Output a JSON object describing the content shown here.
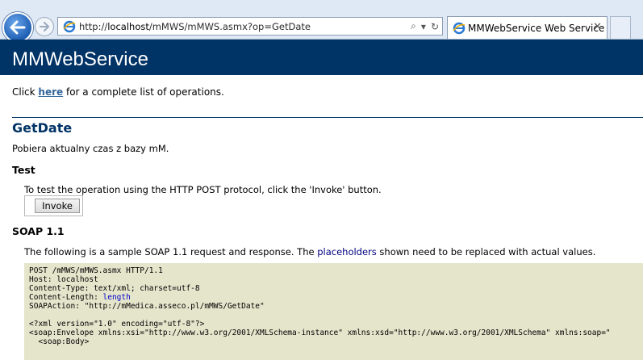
{
  "browser": {
    "address_url_prefix": "http://",
    "address_host": "localhost",
    "address_path": "/mMWS/mMWS.asmx?op=GetDate",
    "tab_title": "MMWebService Web Service",
    "tab_close": "✕",
    "search_glyph": "⌕",
    "dropdown_glyph": "▾",
    "refresh_glyph": "↻"
  },
  "page": {
    "service_name": "MMWebService",
    "intro_before": "Click ",
    "intro_link": "here",
    "intro_after": " for a complete list of operations.",
    "operation_name": "GetDate",
    "operation_description": "Pobiera aktualny czas z bazy mM.",
    "test_heading": "Test",
    "test_text": "To test the operation using the HTTP POST protocol, click the 'Invoke' button.",
    "invoke_label": "Invoke",
    "soap_heading": "SOAP 1.1",
    "soap_desc_before": "The following is a sample SOAP 1.1 request and response. The ",
    "soap_desc_link": "placeholders",
    "soap_desc_after": " shown need to be replaced with actual values."
  },
  "code": {
    "line1": "POST /mMWS/mMWS.asmx HTTP/1.1",
    "line2": "Host: localhost",
    "line3": "Content-Type: text/xml; charset=utf-8",
    "line4_key": "Content-Length: ",
    "line4_val": "length",
    "line5": "SOAPAction: \"http://mMedica.asseco.pl/mMWS/GetDate\"",
    "line6": "<?xml version=\"1.0\" encoding=\"utf-8\"?>",
    "line7": "<soap:Envelope xmlns:xsi=\"http://www.w3.org/2001/XMLSchema-instance\" xmlns:xsd=\"http://www.w3.org/2001/XMLSchema\" xmlns:soap=\"",
    "line8": "  <soap:Body>"
  },
  "colors": {
    "heading_bg": "#003366",
    "link": "#336699",
    "code_bg": "#e5e5cc"
  }
}
